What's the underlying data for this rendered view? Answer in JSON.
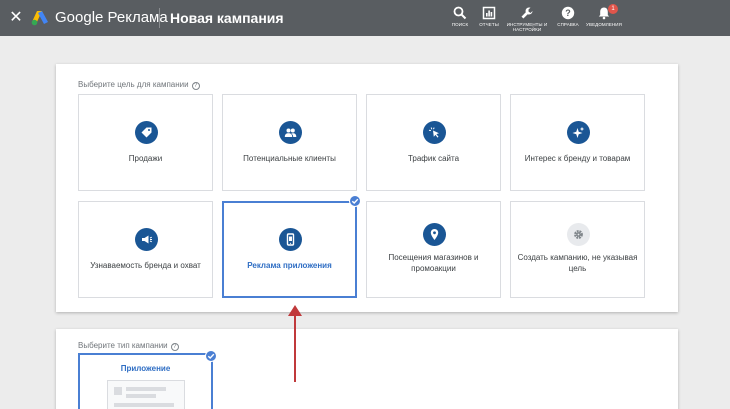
{
  "header": {
    "brand": "Google Реклама",
    "title": "Новая кампания",
    "tools": [
      {
        "icon": "search-icon",
        "label": "ПОИСК"
      },
      {
        "icon": "reports-icon",
        "label": "ОТЧЕТЫ"
      },
      {
        "icon": "wrench-icon",
        "label": "ИНСТРУМЕНТЫ И НАСТРОЙКИ"
      },
      {
        "icon": "help-icon",
        "label": "СПРАВКА"
      },
      {
        "icon": "bell-icon",
        "label": "УВЕДОМЛЕНИЯ",
        "badge": "1"
      }
    ]
  },
  "goal_section": {
    "label": "Выберите цель для кампании",
    "tiles": [
      {
        "label": "Продажи",
        "icon": "tag-icon"
      },
      {
        "label": "Потенциальные клиенты",
        "icon": "people-icon"
      },
      {
        "label": "Трафик сайта",
        "icon": "cursor-click-icon"
      },
      {
        "label": "Интерес к бренду и товарам",
        "icon": "sparkle-icon"
      },
      {
        "label": "Узнаваемость бренда и охват",
        "icon": "megaphone-icon"
      },
      {
        "label": "Реклама приложения",
        "icon": "phone-icon",
        "selected": true
      },
      {
        "label": "Посещения магазинов и промоакции",
        "icon": "location-pin-icon"
      },
      {
        "label": "Создать кампанию, не указывая цель",
        "icon": "gear-icon"
      }
    ]
  },
  "type_section": {
    "label": "Выберите тип кампании",
    "tiles": [
      {
        "label": "Приложение",
        "selected": true
      }
    ]
  },
  "colors": {
    "topbar": "#595d61",
    "icon_blue": "#1a5695",
    "selected_border": "#4a7fd3",
    "arrow": "#c0393b"
  }
}
